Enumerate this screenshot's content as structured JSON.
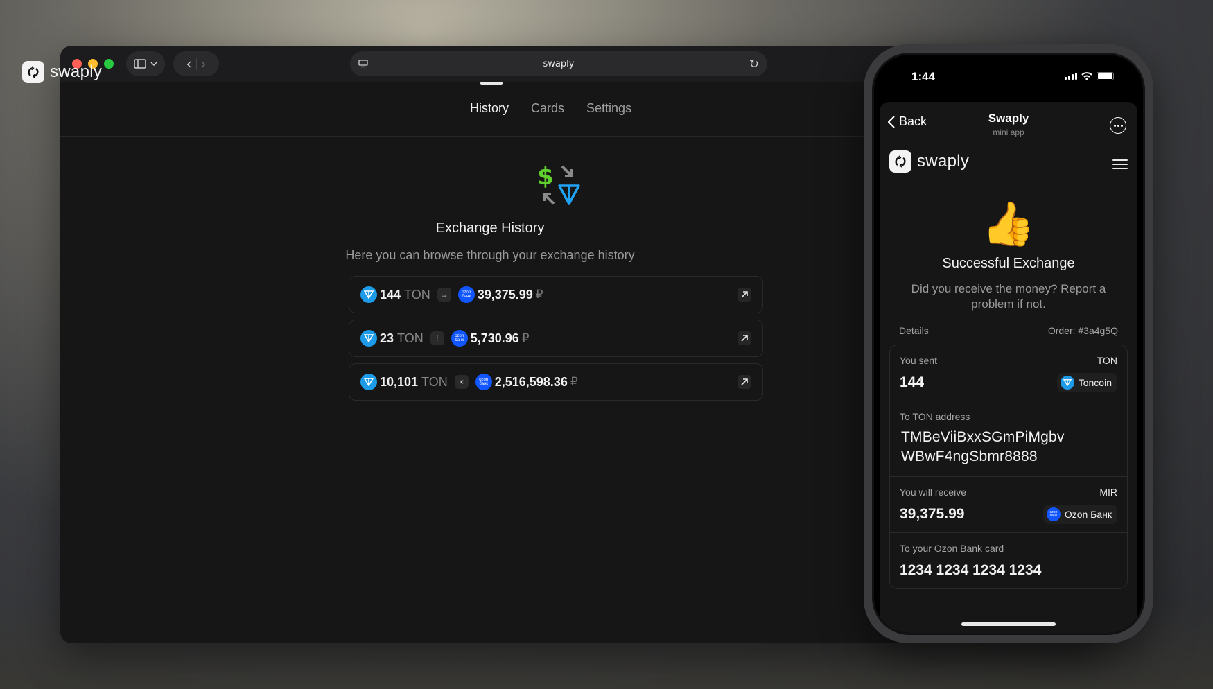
{
  "browser": {
    "url_text": "swaply",
    "logo_text": "swaply",
    "nav": [
      "History",
      "Cards",
      "Settings"
    ],
    "active_tab": "History"
  },
  "history": {
    "title": "Exchange History",
    "subtitle": "Here you can browse through your exchange history",
    "rows": [
      {
        "amount": "144",
        "currency": "TON",
        "status": "→",
        "status_meaning": "completed",
        "received": "39,375.99",
        "rub": "₽"
      },
      {
        "amount": "23",
        "currency": "TON",
        "status": "!",
        "status_meaning": "pending",
        "received": "5,730.96",
        "rub": "₽"
      },
      {
        "amount": "10,101",
        "currency": "TON",
        "status": "×",
        "status_meaning": "failed",
        "received": "2,516,598.36",
        "rub": "₽"
      }
    ]
  },
  "phone": {
    "time": "1:44",
    "back_label": "Back",
    "app_title": "Swaply",
    "app_subtitle": "mini app",
    "logo_text": "swaply",
    "emoji": "👍",
    "success_title": "Successful Exchange",
    "success_sub": "Did you receive the money? Report a problem if not.",
    "details_label": "Details",
    "order_label": "Order: #3a4g5Q",
    "sent": {
      "label": "You sent",
      "currency": "TON",
      "value": "144",
      "pill": "Toncoin"
    },
    "address": {
      "label": "To TON address",
      "line1": "TMBeViiBxxSGmPiMgbv",
      "line2": "WBwF4ngSbmr8888"
    },
    "receive": {
      "label": "You will receive",
      "currency": "MIR",
      "value": "39,375.99",
      "pill": "Ozon Банк"
    },
    "card": {
      "label": "To your Ozon Bank card",
      "value": "1234 1234 1234 1234"
    }
  },
  "colors": {
    "ton_blue": "#1e9be8",
    "ozon_blue": "#1156ff",
    "background": "#161616"
  }
}
